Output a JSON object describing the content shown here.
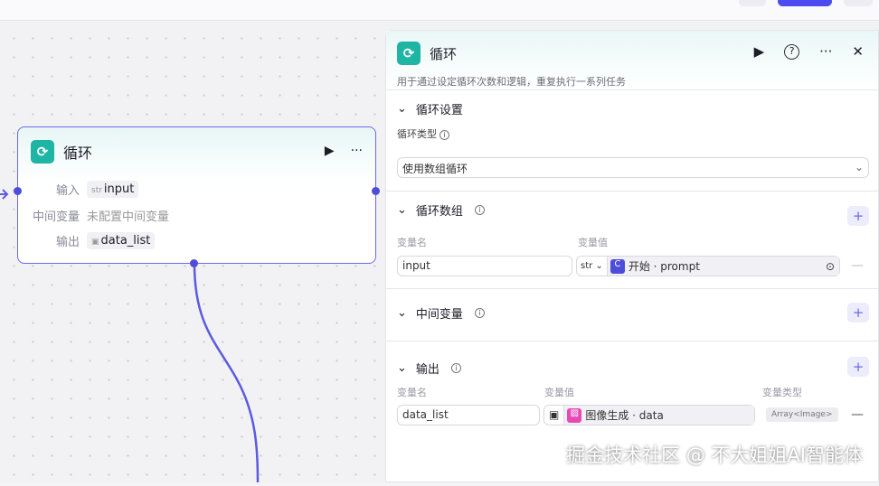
{
  "node": {
    "title": "循环",
    "rows": [
      {
        "label": "输入",
        "type": "str",
        "value": "input"
      },
      {
        "label": "中间变量",
        "value": "未配置中间变量"
      },
      {
        "label": "输出",
        "type": "img",
        "value": "data_list"
      }
    ]
  },
  "panel": {
    "title": "循环",
    "description": "用于通过设定循环次数和逻辑，重复执行一系列任务",
    "loop_settings": {
      "title": "循环设置",
      "type_label": "循环类型",
      "type_value": "使用数组循环"
    },
    "loop_array": {
      "title": "循环数组",
      "name_caption": "变量名",
      "value_caption": "变量值",
      "name": "input",
      "type": "str",
      "ref": "开始 · prompt"
    },
    "intermediate": {
      "title": "中间变量"
    },
    "output": {
      "title": "输出",
      "name_caption": "变量名",
      "value_caption": "变量值",
      "type_caption": "变量类型",
      "name": "data_list",
      "ref": "图像生成 · data",
      "var_type": "Array<Image>"
    }
  },
  "watermark": "掘金技术社区 @ 不大姐姐AI智能体",
  "colors": {
    "accent": "#4d4dd9",
    "loop_icon": "#1fb5a5"
  }
}
